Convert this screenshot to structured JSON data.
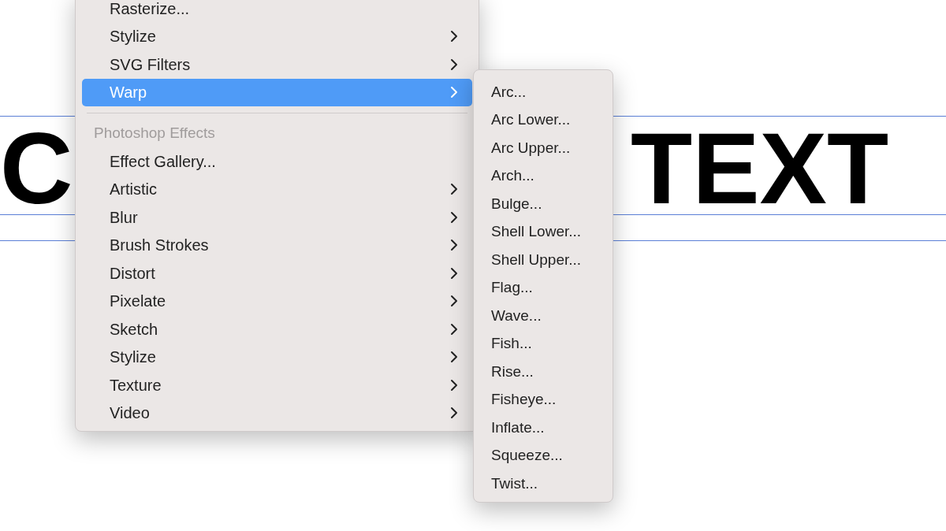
{
  "canvas_text": [
    {
      "text": "C"
    },
    {
      "text": "TEXT"
    }
  ],
  "menu": {
    "items": [
      {
        "kind": "item",
        "label": "Rasterize...",
        "has_submenu": false,
        "selected": false
      },
      {
        "kind": "item",
        "label": "Stylize",
        "has_submenu": true,
        "selected": false
      },
      {
        "kind": "item",
        "label": "SVG Filters",
        "has_submenu": true,
        "selected": false
      },
      {
        "kind": "item",
        "label": "Warp",
        "has_submenu": true,
        "selected": true
      },
      {
        "kind": "separator"
      },
      {
        "kind": "header",
        "label": "Photoshop Effects"
      },
      {
        "kind": "item",
        "label": "Effect Gallery...",
        "has_submenu": false,
        "selected": false
      },
      {
        "kind": "item",
        "label": "Artistic",
        "has_submenu": true,
        "selected": false
      },
      {
        "kind": "item",
        "label": "Blur",
        "has_submenu": true,
        "selected": false
      },
      {
        "kind": "item",
        "label": "Brush Strokes",
        "has_submenu": true,
        "selected": false
      },
      {
        "kind": "item",
        "label": "Distort",
        "has_submenu": true,
        "selected": false
      },
      {
        "kind": "item",
        "label": "Pixelate",
        "has_submenu": true,
        "selected": false
      },
      {
        "kind": "item",
        "label": "Sketch",
        "has_submenu": true,
        "selected": false
      },
      {
        "kind": "item",
        "label": "Stylize",
        "has_submenu": true,
        "selected": false
      },
      {
        "kind": "item",
        "label": "Texture",
        "has_submenu": true,
        "selected": false
      },
      {
        "kind": "item",
        "label": "Video",
        "has_submenu": true,
        "selected": false
      }
    ]
  },
  "submenu": {
    "items": [
      "Arc...",
      "Arc Lower...",
      "Arc Upper...",
      "Arch...",
      "Bulge...",
      "Shell Lower...",
      "Shell Upper...",
      "Flag...",
      "Wave...",
      "Fish...",
      "Rise...",
      "Fisheye...",
      "Inflate...",
      "Squeeze...",
      "Twist..."
    ]
  }
}
